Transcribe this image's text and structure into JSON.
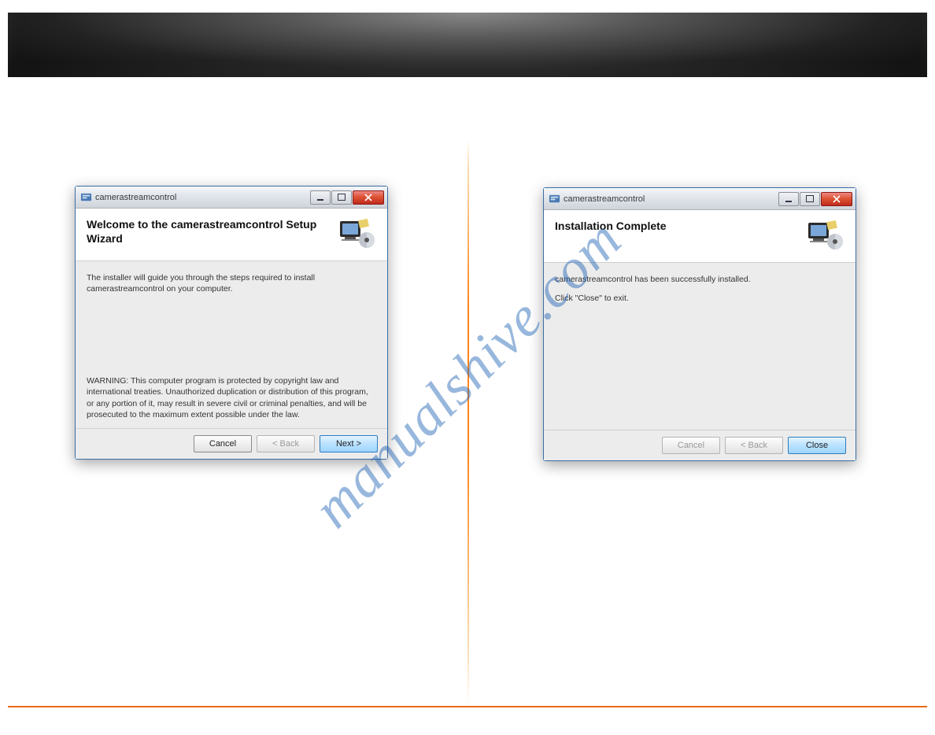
{
  "watermark": "manualshive.com",
  "dialog_left": {
    "title": "camerastreamcontrol",
    "heading": "Welcome to the camerastreamcontrol Setup Wizard",
    "body_intro": "The installer will guide you through the steps required to install camerastreamcontrol on your computer.",
    "body_warning": "WARNING: This computer program is protected by copyright law and international treaties. Unauthorized duplication or distribution of this program, or any portion of it, may result in severe civil or criminal penalties, and will be prosecuted to the maximum extent possible under the law.",
    "buttons": {
      "cancel": "Cancel",
      "back": "< Back",
      "next": "Next >"
    }
  },
  "dialog_right": {
    "title": "camerastreamcontrol",
    "heading": "Installation Complete",
    "body_line1": "camerastreamcontrol has been successfully installed.",
    "body_line2": "Click \"Close\" to exit.",
    "buttons": {
      "cancel": "Cancel",
      "back": "< Back",
      "close": "Close"
    }
  }
}
